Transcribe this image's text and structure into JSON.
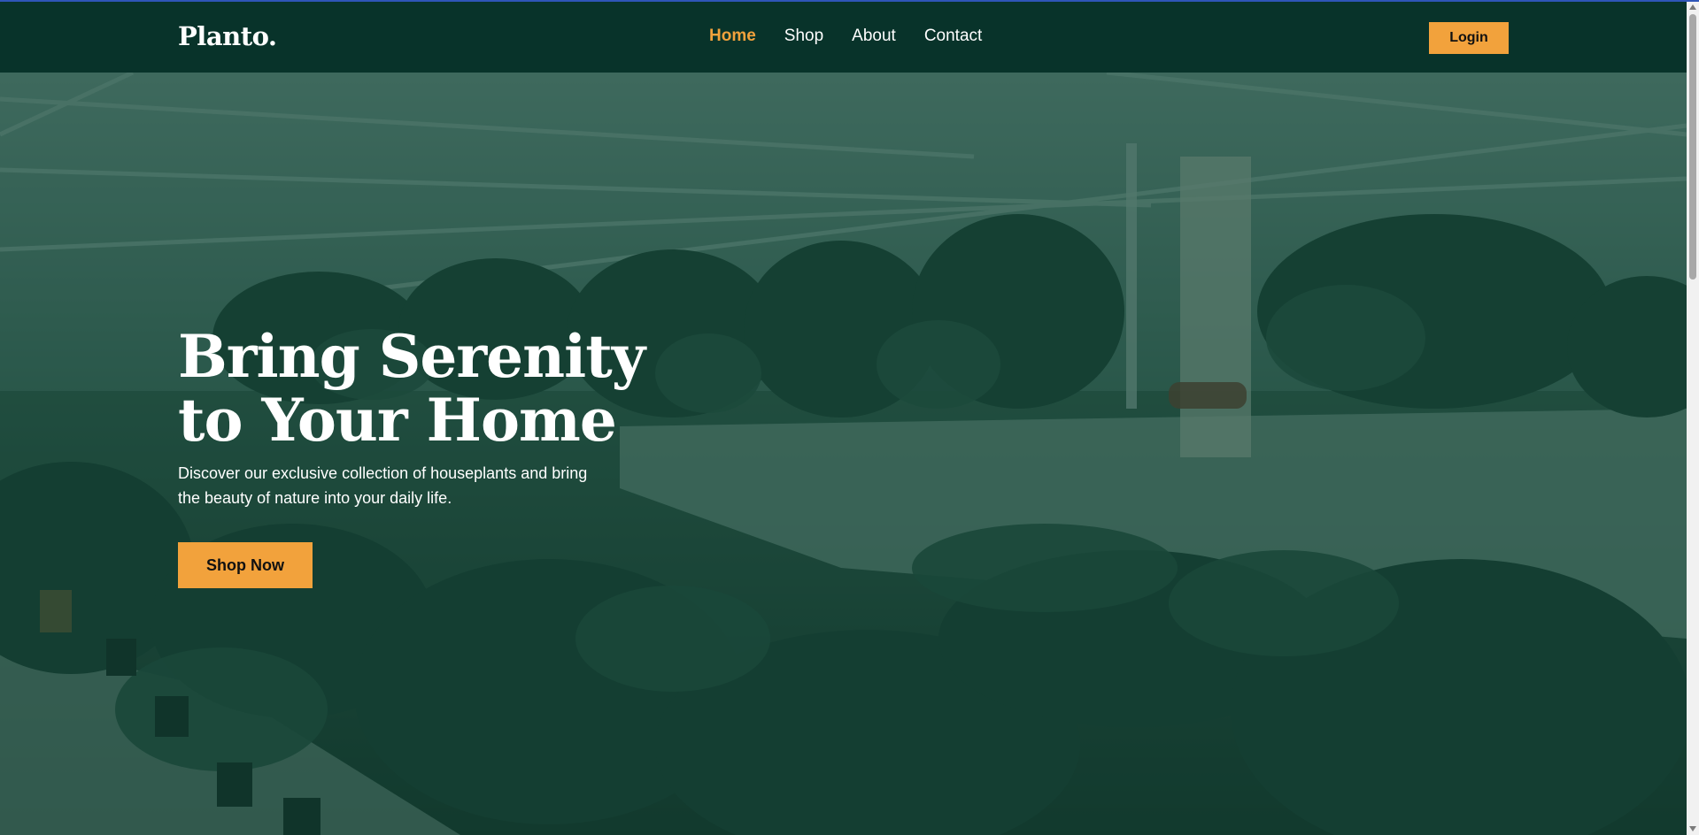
{
  "navbar": {
    "logo": "Planto.",
    "links": [
      {
        "label": "Home",
        "active": true
      },
      {
        "label": "Shop",
        "active": false
      },
      {
        "label": "About",
        "active": false
      },
      {
        "label": "Contact",
        "active": false
      }
    ],
    "login_label": "Login"
  },
  "hero": {
    "title_line1": "Bring Serenity",
    "title_line2": "to Your Home",
    "description": "Discover our exclusive collection of houseplants and bring the beauty of nature into your daily life.",
    "cta_label": "Shop Now",
    "background": "greenhouse-with-hanging-plants-photo"
  },
  "colors": {
    "nav_bg": "#08332a",
    "accent": "#f2a23c",
    "overlay": "#0a382c",
    "text": "#ffffff"
  }
}
